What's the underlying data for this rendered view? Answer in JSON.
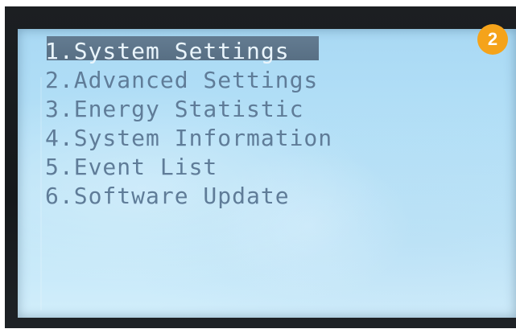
{
  "screen": {
    "badge": "2",
    "selected_index": 0,
    "menu": [
      {
        "label": "1.System Settings"
      },
      {
        "label": "2.Advanced Settings"
      },
      {
        "label": "3.Energy Statistic"
      },
      {
        "label": "4.System Information"
      },
      {
        "label": "5.Event List"
      },
      {
        "label": "6.Software Update"
      }
    ]
  },
  "colors": {
    "lcd_background": "#b4e0f7",
    "text": "#5f7c98",
    "highlight": "#52667a",
    "badge": "#f5a31a"
  }
}
